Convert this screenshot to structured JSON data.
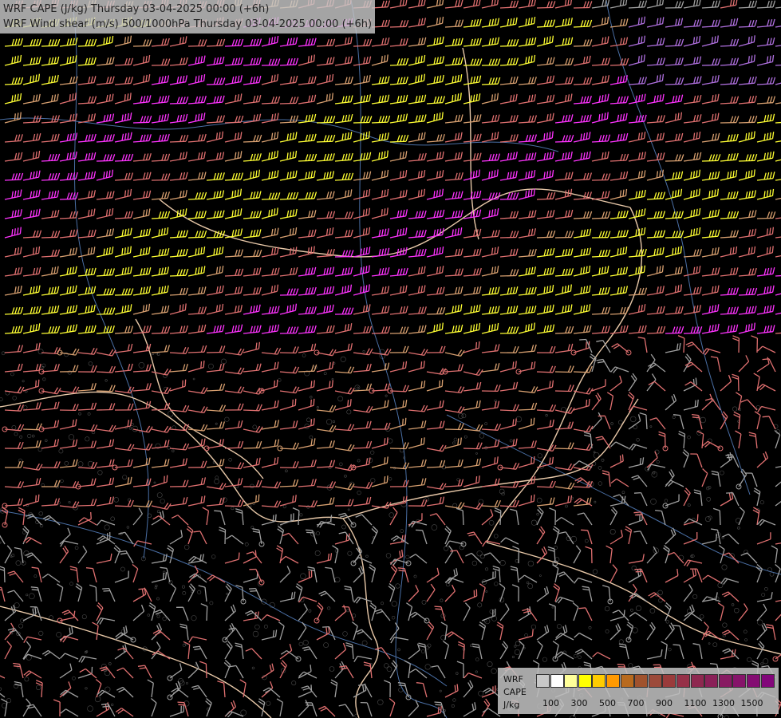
{
  "title": {
    "line1": "WRF CAPE (J/kg) Thursday 03-04-2025 00:00 (+6h)",
    "line2": "WRF Wind shear (m/s) 500/1000hPa Thursday 03-04-2025 00:00 (+6h)"
  },
  "legend": {
    "label_model": "WRF",
    "label_field": "CAPE",
    "label_unit": "J/kg",
    "colors": [
      "#c8c8c8",
      "#ffffff",
      "#ffff99",
      "#ffff00",
      "#ffcc00",
      "#ff9900",
      "#b86a1e",
      "#a0522d",
      "#9c4a3a",
      "#9a3b3b",
      "#963048",
      "#8e2850",
      "#8a2058",
      "#881a62",
      "#86146a",
      "#840c72",
      "#82067a"
    ],
    "ticks": [
      "100",
      "300",
      "500",
      "700",
      "900",
      "1100",
      "1300",
      "1500"
    ]
  },
  "barb_colors": {
    "weak": "#a0a0a0",
    "salmon": "#e07070",
    "tan": "#d8a070",
    "yellow": "#ffff33",
    "magenta": "#ff33ff",
    "purple": "#b070e0",
    "border": "#e8c8a8",
    "river": "#4a6fa5",
    "topo": "#888888"
  }
}
